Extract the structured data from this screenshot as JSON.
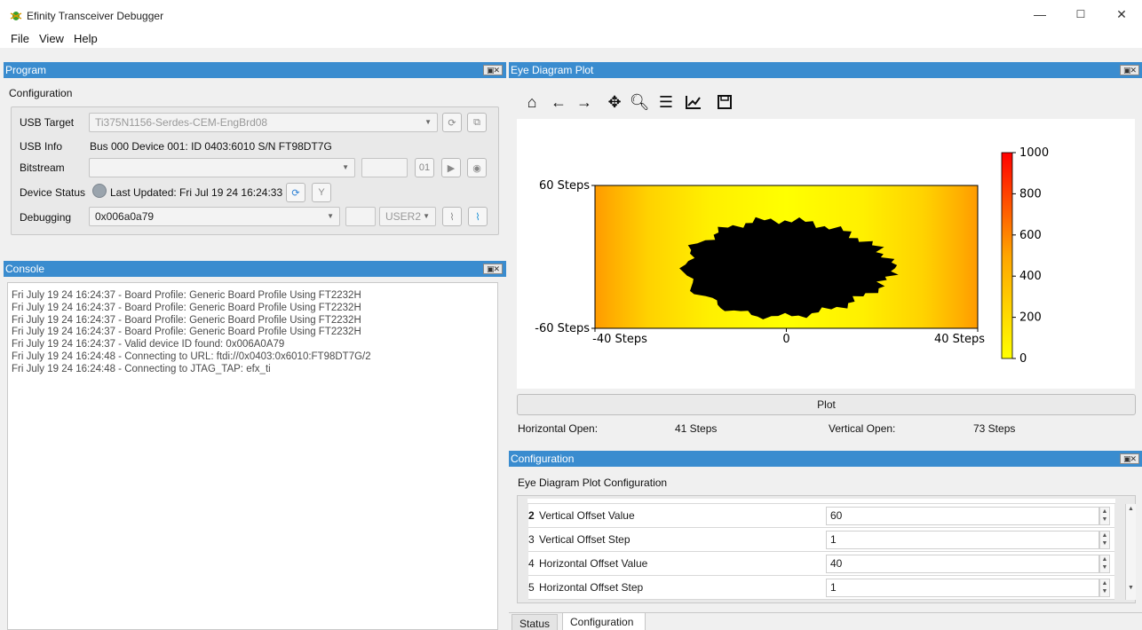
{
  "window": {
    "title": "Efinity Transceiver Debugger",
    "minimize": "—",
    "maximize": "☐",
    "close": "✕"
  },
  "menu": {
    "file": "File",
    "view": "View",
    "help": "Help"
  },
  "program": {
    "panel_title": "Program",
    "group_title": "Configuration",
    "usb_target_label": "USB Target",
    "usb_target_value": "Ti375N1156-Serdes-CEM-EngBrd08",
    "usb_info_label": "USB Info",
    "usb_info_value": "Bus 000 Device 001: ID 0403:6010 S/N FT98DT7G",
    "bitstream_label": "Bitstream",
    "bitstream_value": "",
    "device_status_label": "Device Status",
    "device_status_value": "Last Updated: Fri Jul 19 24 16:24:33",
    "debugging_label": "Debugging",
    "debugging_value": "0x006a0a79",
    "user_select": "USER2"
  },
  "console": {
    "panel_title": "Console",
    "lines": [
      "Fri July 19 24 16:24:37 - Board Profile: Generic Board Profile Using FT2232H",
      "Fri July 19 24 16:24:37 - Board Profile: Generic Board Profile Using FT2232H",
      "Fri July 19 24 16:24:37 - Board Profile: Generic Board Profile Using FT2232H",
      "Fri July 19 24 16:24:37 - Board Profile: Generic Board Profile Using FT2232H",
      "Fri July 19 24 16:24:37 - Valid device ID found: 0x006A0A79",
      "Fri July 19 24 16:24:48 - Connecting to URL: ftdi://0x0403:0x6010:FT98DT7G/2",
      "Fri July 19 24 16:24:48 - Connecting to JTAG_TAP: efx_ti"
    ]
  },
  "eye": {
    "panel_title": "Eye Diagram Plot",
    "toolbar_icons": [
      "home-icon",
      "back-arrow-icon",
      "forward-arrow-icon",
      "pan-icon",
      "zoom-icon",
      "subplots-icon",
      "axes-icon",
      "save-icon"
    ],
    "plot_button": "Plot",
    "horizontal_open_label": "Horizontal Open:",
    "horizontal_open_value": "41 Steps",
    "vertical_open_label": "Vertical Open:",
    "vertical_open_value": "73 Steps"
  },
  "chart_data": {
    "type": "heatmap",
    "x_ticks": [
      "-40 Steps",
      "0",
      "40 Steps"
    ],
    "y_ticks": [
      "60 Steps",
      "-60 Steps"
    ],
    "xlim": [
      -40,
      40
    ],
    "ylim": [
      -60,
      60
    ],
    "colorbar_ticks": [
      "1000",
      "800",
      "600",
      "400",
      "200",
      "0"
    ],
    "colorbar_range": [
      0,
      1000
    ],
    "colormap": [
      "#ffff00",
      "#ffa500",
      "#ff0000"
    ],
    "eye_color": "#000000"
  },
  "config": {
    "panel_title": "Configuration",
    "group_title": "Eye Diagram Plot Configuration",
    "rows": [
      {
        "idx": "2",
        "name": "Vertical Offset Value",
        "value": "60"
      },
      {
        "idx": "3",
        "name": "Vertical Offset Step",
        "value": "1"
      },
      {
        "idx": "4",
        "name": "Horizontal Offset Value",
        "value": "40"
      },
      {
        "idx": "5",
        "name": "Horizontal Offset Step",
        "value": "1"
      }
    ]
  },
  "tabs": {
    "status": "Status",
    "configuration": "Configuration"
  }
}
